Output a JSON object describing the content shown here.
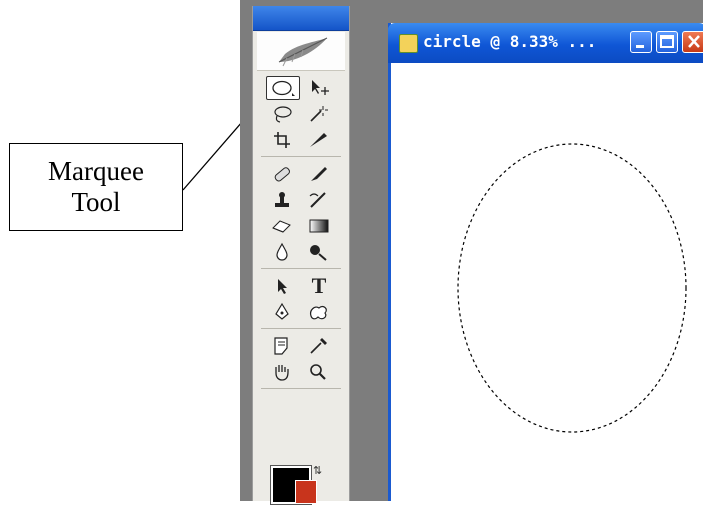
{
  "callout": {
    "line1": "Marquee",
    "line2": "Tool"
  },
  "document": {
    "title": "circle @ 8.33% ..."
  },
  "toolbox": {
    "selected_tool": "elliptical-marquee",
    "tools": [
      "elliptical-marquee",
      "move",
      "lasso",
      "magic-wand",
      "crop",
      "slice",
      "healing-brush",
      "brush",
      "clone-stamp",
      "history-brush",
      "eraser",
      "gradient",
      "blur",
      "dodge",
      "path-selection",
      "type",
      "pen",
      "custom-shape",
      "notes",
      "eyedropper",
      "hand",
      "zoom"
    ],
    "type_tool_glyph": "T"
  },
  "colors": {
    "foreground": "#000000",
    "background": "#c8341c",
    "accent": "#1454c8"
  }
}
